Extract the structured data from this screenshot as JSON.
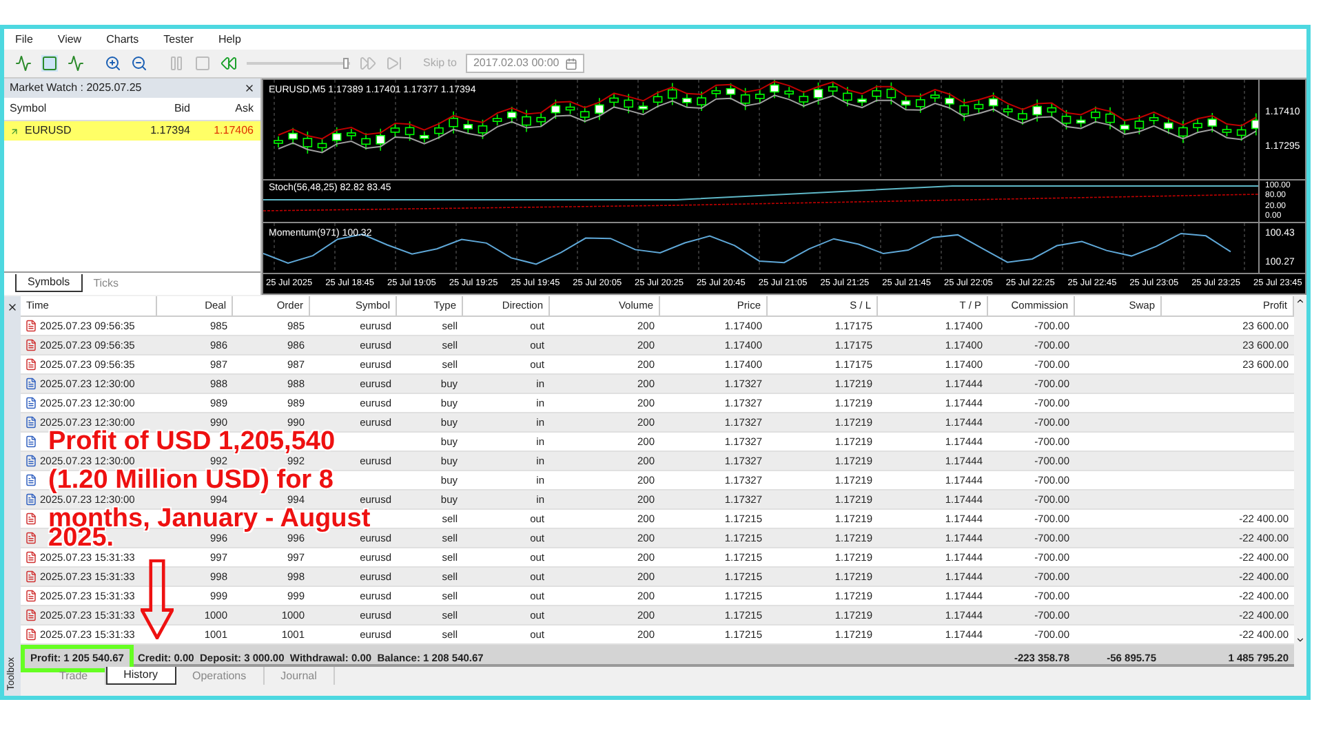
{
  "menu": [
    "File",
    "View",
    "Charts",
    "Tester",
    "Help"
  ],
  "toolbar": {
    "skip_label": "Skip to",
    "date": "2017.02.03 00:00",
    "level": 0.98
  },
  "market_watch": {
    "title": "Market Watch : 2025.07.25",
    "columns": [
      "Symbol",
      "Bid",
      "Ask"
    ],
    "rows": [
      {
        "symbol": "EURUSD",
        "bid": "1.17394",
        "ask": "1.17406",
        "selected": true
      }
    ],
    "tabs": [
      {
        "label": "Symbols",
        "selected": true
      },
      {
        "label": "Ticks",
        "selected": false
      }
    ]
  },
  "chart": {
    "title": "EURUSD,M5  1.17389 1.17401 1.17377 1.17394",
    "price_labels": [
      "1.17410",
      "1.17295"
    ],
    "stoch_label": "Stoch(56,48,25) 82.82 83.45",
    "stoch_scale": [
      "100.00",
      "80.00",
      "20.00",
      "0.00"
    ],
    "momentum_label": "Momentum(971) 100.32",
    "momentum_scale": [
      "100.43",
      "100.27"
    ],
    "time_labels": [
      "25 Jul 2025",
      "25 Jul 18:45",
      "25 Jul 19:05",
      "25 Jul 19:25",
      "25 Jul 19:45",
      "25 Jul 20:05",
      "25 Jul 20:25",
      "25 Jul 20:45",
      "25 Jul 21:05",
      "25 Jul 21:25",
      "25 Jul 21:45",
      "25 Jul 22:05",
      "25 Jul 22:25",
      "25 Jul 22:45",
      "25 Jul 23:05",
      "25 Jul 23:25",
      "25 Jul 23:45"
    ]
  },
  "toolbox": {
    "label": "Toolbox",
    "columns": [
      "Time",
      "Deal",
      "Order",
      "Symbol",
      "Type",
      "Direction",
      "Volume",
      "Price",
      "S / L",
      "T / P",
      "Commission",
      "Swap",
      "Profit"
    ],
    "rows": [
      {
        "kind": "sell",
        "time": "2025.07.23 09:56:35",
        "deal": "985",
        "order": "985",
        "symbol": "eurusd",
        "type": "sell",
        "direction": "out",
        "volume": "200",
        "price": "1.17400",
        "sl": "1.17175",
        "tp": "1.17400",
        "commission": "-700.00",
        "profit": "23 600.00"
      },
      {
        "kind": "sell",
        "time": "2025.07.23 09:56:35",
        "deal": "986",
        "order": "986",
        "symbol": "eurusd",
        "type": "sell",
        "direction": "out",
        "volume": "200",
        "price": "1.17400",
        "sl": "1.17175",
        "tp": "1.17400",
        "commission": "-700.00",
        "profit": "23 600.00"
      },
      {
        "kind": "sell",
        "time": "2025.07.23 09:56:35",
        "deal": "987",
        "order": "987",
        "symbol": "eurusd",
        "type": "sell",
        "direction": "out",
        "volume": "200",
        "price": "1.17400",
        "sl": "1.17175",
        "tp": "1.17400",
        "commission": "-700.00",
        "profit": "23 600.00"
      },
      {
        "kind": "buy",
        "time": "2025.07.23 12:30:00",
        "deal": "988",
        "order": "988",
        "symbol": "eurusd",
        "type": "buy",
        "direction": "in",
        "volume": "200",
        "price": "1.17327",
        "sl": "1.17219",
        "tp": "1.17444",
        "commission": "-700.00"
      },
      {
        "kind": "buy",
        "time": "2025.07.23 12:30:00",
        "deal": "989",
        "order": "989",
        "symbol": "eurusd",
        "type": "buy",
        "direction": "in",
        "volume": "200",
        "price": "1.17327",
        "sl": "1.17219",
        "tp": "1.17444",
        "commission": "-700.00"
      },
      {
        "kind": "buy",
        "time": "2025.07.23 12:30:00",
        "deal": "990",
        "order": "990",
        "symbol": "eurusd",
        "type": "buy",
        "direction": "in",
        "volume": "200",
        "price": "1.17327",
        "sl": "1.17219",
        "tp": "1.17444",
        "commission": "-700.00"
      },
      {
        "kind": "buy",
        "type": "buy",
        "direction": "in",
        "volume": "200",
        "price": "1.17327",
        "sl": "1.17219",
        "tp": "1.17444",
        "commission": "-700.00"
      },
      {
        "kind": "buy",
        "time": "2025.07.23 12:30:00",
        "deal": "992",
        "order": "992",
        "symbol": "eurusd",
        "type": "buy",
        "direction": "in",
        "volume": "200",
        "price": "1.17327",
        "sl": "1.17219",
        "tp": "1.17444",
        "commission": "-700.00"
      },
      {
        "kind": "buy",
        "type": "buy",
        "direction": "in",
        "volume": "200",
        "price": "1.17327",
        "sl": "1.17219",
        "tp": "1.17444",
        "commission": "-700.00"
      },
      {
        "kind": "buy",
        "time": "2025.07.23 12:30:00",
        "deal": "994",
        "order": "994",
        "symbol": "eurusd",
        "type": "buy",
        "direction": "in",
        "volume": "200",
        "price": "1.17327",
        "sl": "1.17219",
        "tp": "1.17444",
        "commission": "-700.00"
      },
      {
        "kind": "sell",
        "type": "sell",
        "direction": "out",
        "volume": "200",
        "price": "1.17215",
        "sl": "1.17219",
        "tp": "1.17444",
        "commission": "-700.00",
        "profit": "-22 400.00"
      },
      {
        "kind": "sell",
        "deal": "996",
        "order": "996",
        "symbol": "eurusd",
        "type": "sell",
        "direction": "out",
        "volume": "200",
        "price": "1.17215",
        "sl": "1.17219",
        "tp": "1.17444",
        "commission": "-700.00",
        "profit": "-22 400.00"
      },
      {
        "kind": "sell",
        "time": "2025.07.23 15:31:33",
        "deal": "997",
        "order": "997",
        "symbol": "eurusd",
        "type": "sell",
        "direction": "out",
        "volume": "200",
        "price": "1.17215",
        "sl": "1.17219",
        "tp": "1.17444",
        "commission": "-700.00",
        "profit": "-22 400.00"
      },
      {
        "kind": "sell",
        "time": "2025.07.23 15:31:33",
        "deal": "998",
        "order": "998",
        "symbol": "eurusd",
        "type": "sell",
        "direction": "out",
        "volume": "200",
        "price": "1.17215",
        "sl": "1.17219",
        "tp": "1.17444",
        "commission": "-700.00",
        "profit": "-22 400.00"
      },
      {
        "kind": "sell",
        "time": "2025.07.23 15:31:33",
        "deal": "999",
        "order": "999",
        "symbol": "eurusd",
        "type": "sell",
        "direction": "out",
        "volume": "200",
        "price": "1.17215",
        "sl": "1.17219",
        "tp": "1.17444",
        "commission": "-700.00",
        "profit": "-22 400.00"
      },
      {
        "kind": "sell",
        "time": "2025.07.23 15:31:33",
        "deal": "1000",
        "order": "1000",
        "symbol": "eurusd",
        "type": "sell",
        "direction": "out",
        "volume": "200",
        "price": "1.17215",
        "sl": "1.17219",
        "tp": "1.17444",
        "commission": "-700.00",
        "profit": "-22 400.00"
      },
      {
        "kind": "sell",
        "time": "2025.07.23 15:31:33",
        "deal": "1001",
        "order": "1001",
        "symbol": "eurusd",
        "type": "sell",
        "direction": "out",
        "volume": "200",
        "price": "1.17215",
        "sl": "1.17219",
        "tp": "1.17444",
        "commission": "-700.00",
        "profit": "-22 400.00"
      }
    ],
    "summary": {
      "profit": "Profit: 1 205 540.67",
      "details": "Credit: 0.00  Deposit: 3 000.00  Withdrawal: 0.00  Balance: 1 208 540.67",
      "commission": "-223 358.78",
      "swap": "-56 895.75",
      "total_profit": "1 485 795.20"
    },
    "tabs": [
      {
        "label": "Trade",
        "selected": false
      },
      {
        "label": "History",
        "selected": true
      },
      {
        "label": "Operations",
        "selected": false
      },
      {
        "label": "Journal",
        "selected": false
      }
    ]
  },
  "annotation": {
    "lines": [
      "Profit of USD 1,205,540",
      "(1.20 Million USD) for 8",
      "months, January - August",
      "2025."
    ]
  }
}
